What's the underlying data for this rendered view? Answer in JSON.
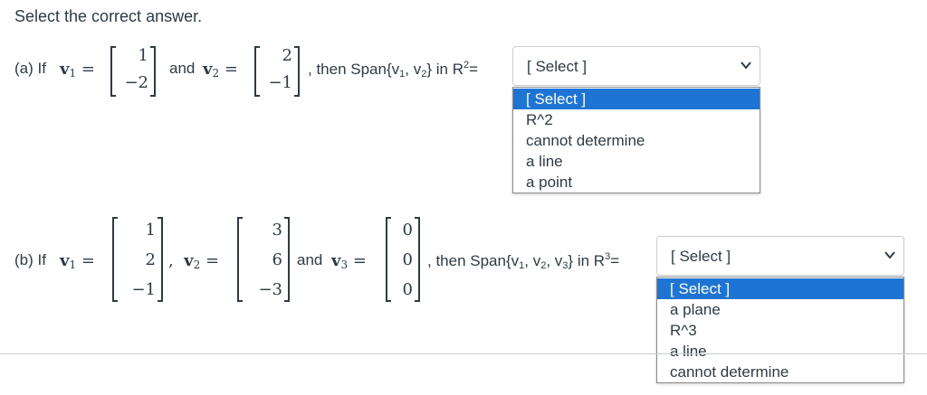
{
  "prompt": "Select the correct answer.",
  "part_a": {
    "label": "(a) If",
    "v1_name": "v",
    "v1_sub": "1",
    "v1": [
      "1",
      "−2"
    ],
    "and": "and",
    "v2_name": "v",
    "v2_sub": "2",
    "v2": [
      "2",
      "−1"
    ],
    "then_pre": ", then Span{v",
    "then_sub1": "1",
    "then_mid": ", v",
    "then_sub2": "2",
    "then_post": "} in R",
    "sup": "2",
    "eq": "=",
    "select_value": "[ Select ]",
    "options": [
      "[ Select ]",
      "R^2",
      "cannot determine",
      "a line",
      "a point"
    ]
  },
  "part_b": {
    "label": "(b) If",
    "v1_name": "v",
    "v1_sub": "1",
    "v1": [
      "1",
      "2",
      "−1"
    ],
    "v2_name": "v",
    "v2_sub": "2",
    "v2": [
      "3",
      "6",
      "−3"
    ],
    "and": "and",
    "v3_name": "v",
    "v3_sub": "3",
    "v3": [
      "0",
      "0",
      "0"
    ],
    "then_pre": ", then Span{v",
    "then_sub1": "1",
    "then_mid1": ", v",
    "then_sub2": "2",
    "then_mid2": ", v",
    "then_sub3": "3",
    "then_post": "} in R",
    "sup": "3",
    "eq": "=",
    "select_value": "[ Select ]",
    "options": [
      "[ Select ]",
      "a plane",
      "R^3",
      "a line",
      "cannot determine"
    ]
  }
}
